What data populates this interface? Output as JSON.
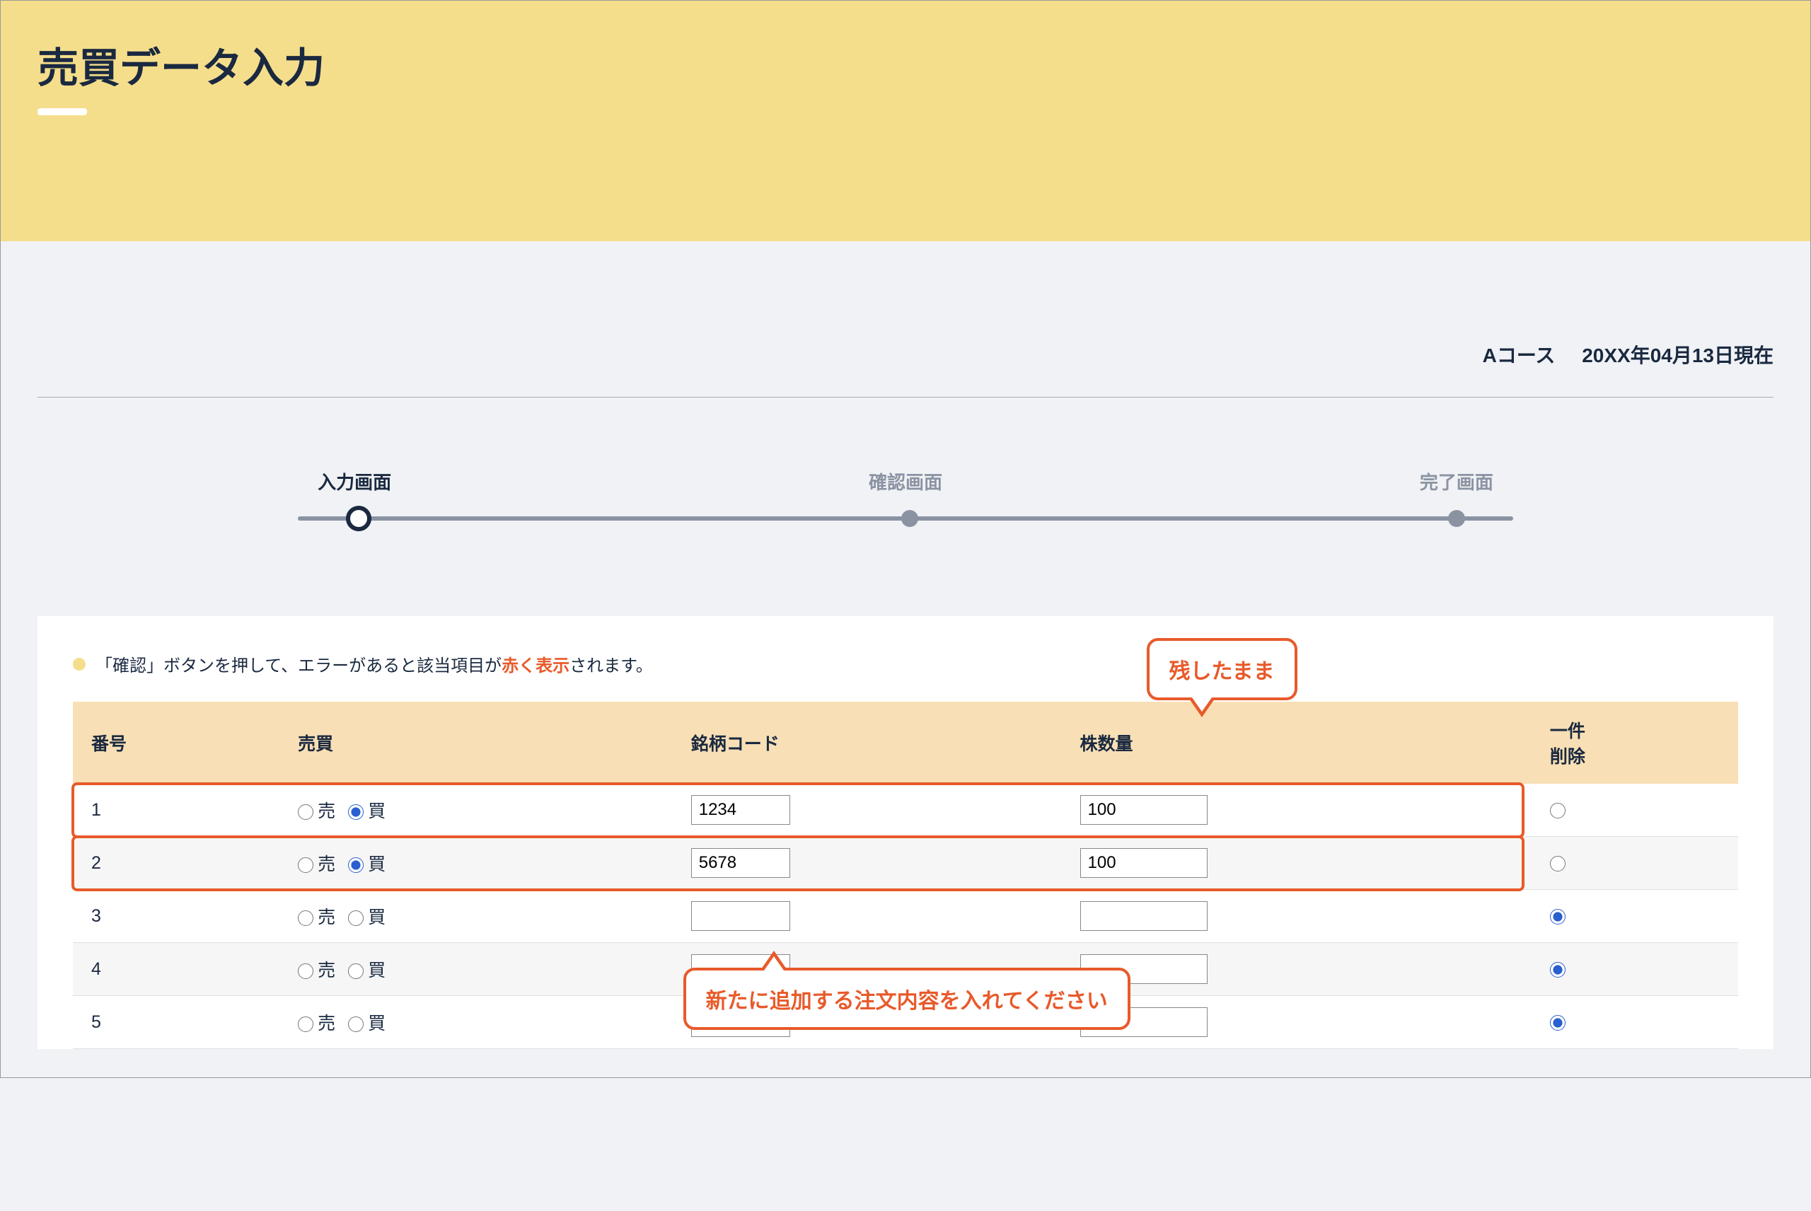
{
  "hero": {
    "title": "売買データ入力"
  },
  "meta": {
    "course": "Aコース",
    "asof": "20XX年04月13日現在"
  },
  "stepper": {
    "steps": [
      "入力画面",
      "確認画面",
      "完了画面"
    ],
    "active": 0
  },
  "hint": {
    "pre": "「確認」ボタンを押して、エラーがあると該当項目が",
    "red": "赤く表示",
    "post": "されます。"
  },
  "table": {
    "headers": {
      "no": "番号",
      "side": "売買",
      "code": "銘柄コード",
      "qty": "株数量",
      "del": "一件\n削除"
    },
    "side_labels": {
      "sell": "売",
      "buy": "買"
    },
    "rows": [
      {
        "no": "1",
        "sell": false,
        "buy": true,
        "code": "1234",
        "qty": "100",
        "del": false,
        "highlight": true
      },
      {
        "no": "2",
        "sell": false,
        "buy": true,
        "code": "5678",
        "qty": "100",
        "del": false,
        "highlight": true
      },
      {
        "no": "3",
        "sell": false,
        "buy": false,
        "code": "",
        "qty": "",
        "del": true,
        "highlight": false
      },
      {
        "no": "4",
        "sell": false,
        "buy": false,
        "code": "",
        "qty": "",
        "del": true,
        "highlight": false
      },
      {
        "no": "5",
        "sell": false,
        "buy": false,
        "code": "",
        "qty": "",
        "del": true,
        "highlight": false
      }
    ]
  },
  "callouts": {
    "keep": "残したまま",
    "add": "新たに追加する注文内容を入れてください"
  }
}
